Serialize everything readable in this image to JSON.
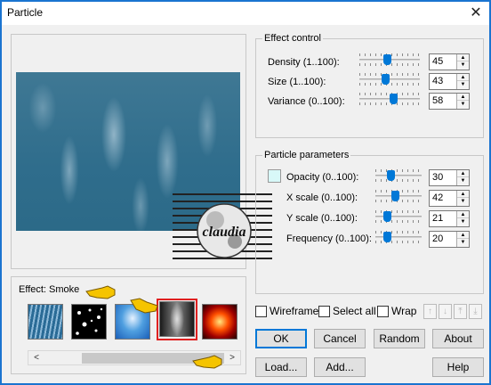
{
  "window": {
    "title": "Particle",
    "close_glyph": "✕"
  },
  "preview": {
    "watermark_text": "claudia"
  },
  "effect": {
    "label": "Effect: Smoke",
    "thumbnails": [
      {
        "name": "rain",
        "selected": false
      },
      {
        "name": "snow",
        "selected": false
      },
      {
        "name": "clouds",
        "selected": false
      },
      {
        "name": "smoke",
        "selected": true
      },
      {
        "name": "fire",
        "selected": false
      }
    ],
    "scroll_left": "<",
    "scroll_right": ">"
  },
  "effect_control": {
    "title": "Effect control",
    "rows": [
      {
        "label": "Density (1..100):",
        "value": "45",
        "level": 0.45
      },
      {
        "label": "Size (1..100):",
        "value": "43",
        "level": 0.43
      },
      {
        "label": "Variance (0..100):",
        "value": "58",
        "level": 0.58
      }
    ]
  },
  "particle_params": {
    "title": "Particle parameters",
    "swatch_color": "#d8f8f8",
    "rows": [
      {
        "label": "Opacity (0..100):",
        "value": "30",
        "level": 0.3
      },
      {
        "label": "X scale (0..100):",
        "value": "42",
        "level": 0.42
      },
      {
        "label": "Y scale (0..100):",
        "value": "21",
        "level": 0.21
      },
      {
        "label": "Frequency (0..100):",
        "value": "20",
        "level": 0.2
      }
    ]
  },
  "options": {
    "wireframe": "Wireframe",
    "select_all": "Select all",
    "wrap": "Wrap",
    "arrows": [
      "↑",
      "↓",
      "⤒",
      "⤓"
    ]
  },
  "buttons": {
    "ok": "OK",
    "cancel": "Cancel",
    "random": "Random",
    "about": "About",
    "load": "Load...",
    "add": "Add...",
    "help": "Help"
  },
  "colors": {
    "accent": "#0078d7",
    "selection": "#e02020"
  }
}
